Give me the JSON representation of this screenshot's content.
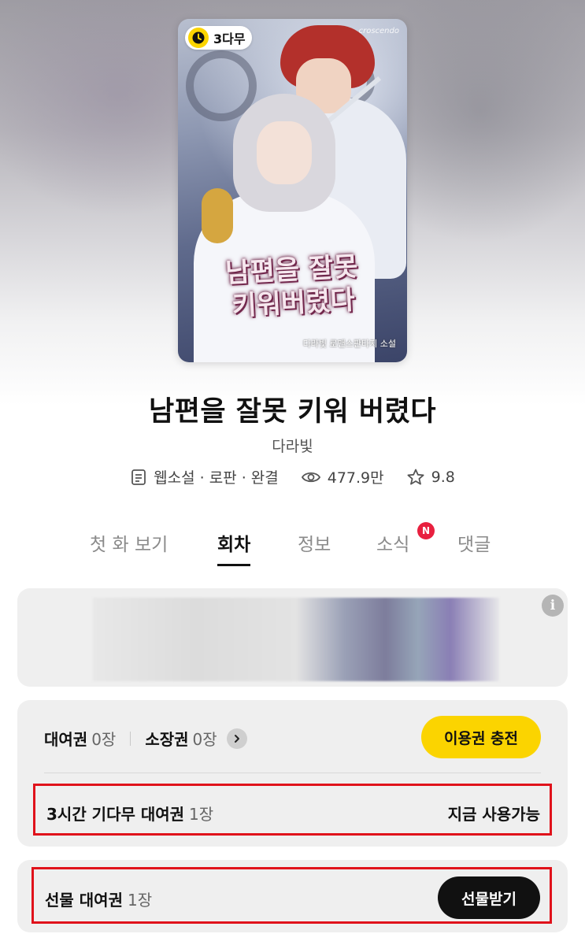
{
  "cover": {
    "badge_label": "3다무",
    "title_art": "남편을 잘못\n키워버렸다",
    "subtitle_art": "다라빛 로맨스판타지 소설",
    "publisher_logo": "croscendo"
  },
  "work": {
    "title": "남편을 잘못 키워 버렸다",
    "author": "다라빛",
    "genre": "웹소설 · 로판 · 완결",
    "views": "477.9만",
    "rating": "9.8"
  },
  "tabs": [
    {
      "label": "첫 화 보기",
      "active": false
    },
    {
      "label": "회차",
      "active": true
    },
    {
      "label": "정보",
      "active": false
    },
    {
      "label": "소식",
      "active": false,
      "badge": "N"
    },
    {
      "label": "댓글",
      "active": false
    }
  ],
  "tickets": {
    "rental_label": "대여권",
    "rental_count": "0장",
    "owned_label": "소장권",
    "owned_count": "0장",
    "charge_button": "이용권 충전",
    "wait_label": "3시간 기다무 대여권",
    "wait_count": "1장",
    "wait_status": "지금 사용가능"
  },
  "gift": {
    "label": "선물 대여권",
    "count": "1장",
    "button": "선물받기"
  },
  "colors": {
    "accent_yellow": "#fbd400",
    "badge_red": "#e8203f",
    "highlight_red": "#e0121b"
  },
  "icons": {
    "info": "i"
  }
}
